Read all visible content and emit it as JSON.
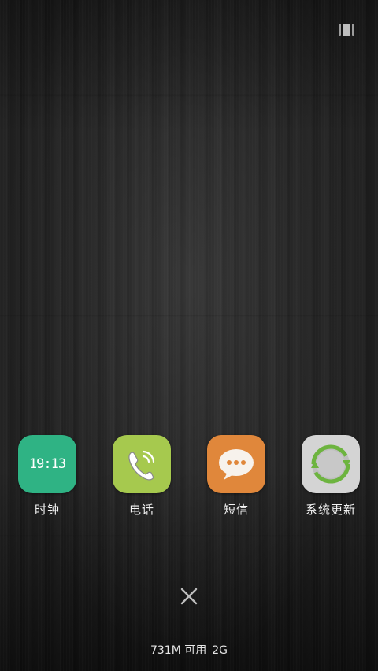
{
  "recents": {
    "icon": "recents-icon"
  },
  "apps": [
    {
      "label": "时钟",
      "icon": "clock-icon",
      "color": "#2fb384",
      "clock_time": "19:13"
    },
    {
      "label": "电话",
      "icon": "phone-icon",
      "color": "#a6c94e"
    },
    {
      "label": "短信",
      "icon": "message-icon",
      "color": "#e0873b"
    },
    {
      "label": "系统更新",
      "icon": "system-update-icon",
      "color": "#cfcfcf",
      "accent": "#6db43f"
    }
  ],
  "close_all": {
    "icon": "close-icon"
  },
  "memory": {
    "available": "731M 可用",
    "network": "2G"
  }
}
